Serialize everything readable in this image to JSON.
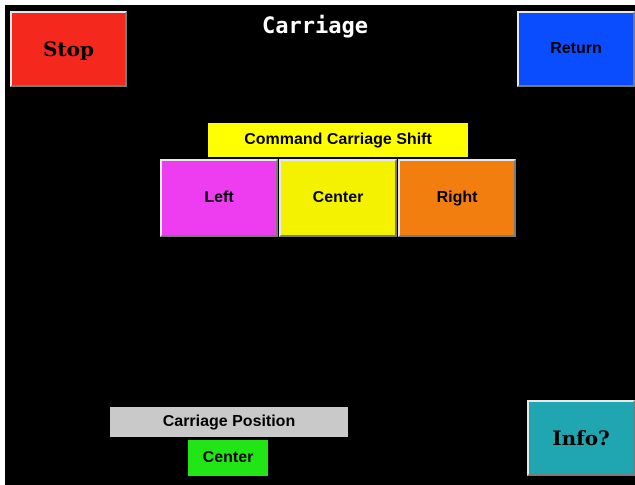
{
  "screen": {
    "title": "Carriage"
  },
  "header": {
    "stop_label": "Stop",
    "return_label": "Return"
  },
  "command": {
    "title": "Command Carriage Shift",
    "buttons": [
      {
        "label": "Left",
        "color": "#ee3cf0"
      },
      {
        "label": "Center",
        "color": "#f5f200"
      },
      {
        "label": "Right",
        "color": "#f17e0e"
      }
    ]
  },
  "position": {
    "label": "Carriage Position",
    "value": "Center",
    "value_color": "#22e515"
  },
  "info": {
    "label": "Info?"
  },
  "colors": {
    "background": "#000000",
    "stop": "#f5281e",
    "return": "#0a4dff",
    "info": "#1fa6b0",
    "command_label": "#ffff00",
    "position_label": "#c9c9c9"
  }
}
